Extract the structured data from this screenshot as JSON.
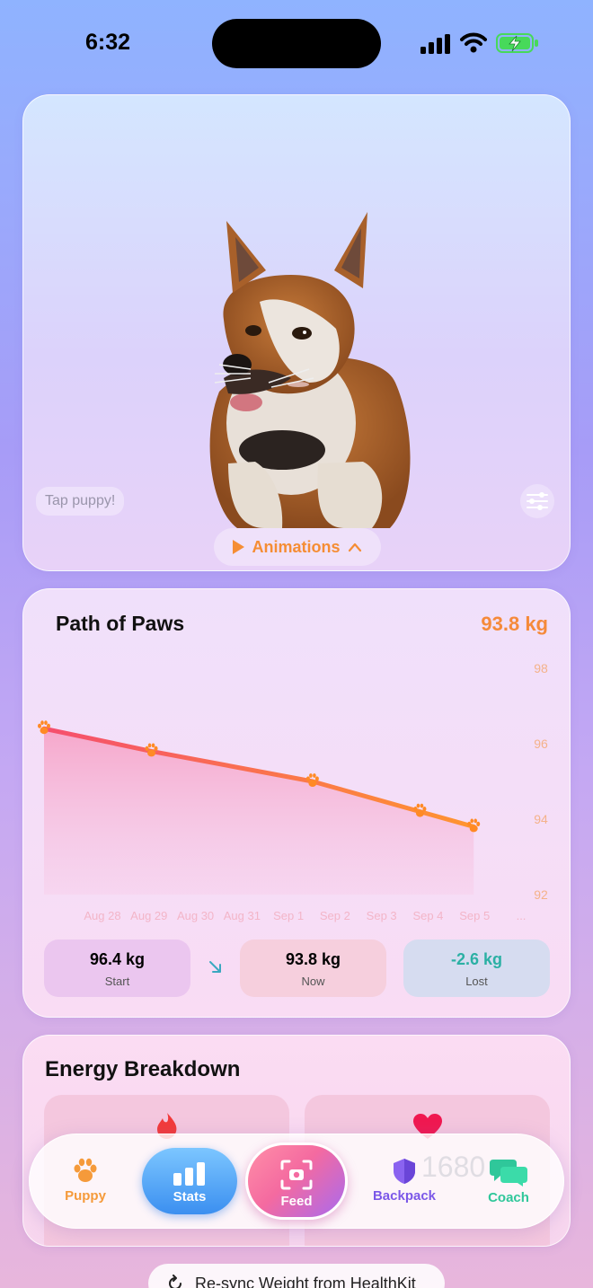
{
  "status_bar": {
    "time": "6:32",
    "icons": [
      "signal-icon",
      "wifi-icon",
      "battery-charging-icon"
    ],
    "battery_color": "#47d95a"
  },
  "puppy_card": {
    "tap_hint": "Tap puppy!",
    "animations_label": "Animations",
    "icons": [
      "settings-sliders-icon",
      "play-icon",
      "chevron-up-icon"
    ]
  },
  "chart_card": {
    "title": "Path of Paws",
    "current_value": "93.8 kg",
    "stats": {
      "start": {
        "value": "96.4 kg",
        "label": "Start"
      },
      "now": {
        "value": "93.8 kg",
        "label": "Now"
      },
      "lost": {
        "value": "-2.6 kg",
        "label": "Lost"
      }
    }
  },
  "chart_data": {
    "type": "area",
    "x": [
      "Aug 28",
      "Aug 29",
      "Aug 30",
      "Aug 31",
      "Sep 1",
      "Sep 2",
      "Sep 3",
      "Sep 4",
      "Sep 5",
      "..."
    ],
    "series": [
      {
        "values": [
          96.4,
          95.8,
          95.0,
          94.2,
          93.8
        ],
        "at": [
          "Aug 28",
          "Aug 30",
          "Sep 2",
          "Sep 4",
          "Sep 5"
        ]
      }
    ],
    "yticks": [
      98,
      96,
      94,
      92
    ],
    "ylim": [
      92,
      98
    ],
    "line_colors": [
      "#f54e6e",
      "#ff9530"
    ],
    "marker": "paw",
    "grid": false
  },
  "energy_card": {
    "title": "Energy Breakdown",
    "icons": [
      "flame-icon",
      "heart-icon"
    ],
    "hidden_value": "1680"
  },
  "tab_bar": {
    "items": [
      {
        "label": "Puppy",
        "icon": "paw-icon"
      },
      {
        "label": "Stats",
        "icon": "bar-chart-icon"
      },
      {
        "label": "Feed",
        "icon": "camera-scan-icon"
      },
      {
        "label": "Backpack",
        "icon": "shield-icon"
      },
      {
        "label": "Coach",
        "icon": "chat-bubbles-icon"
      }
    ]
  },
  "resync": {
    "label": "Re-sync Weight from HealthKit",
    "icon": "refresh-icon"
  }
}
